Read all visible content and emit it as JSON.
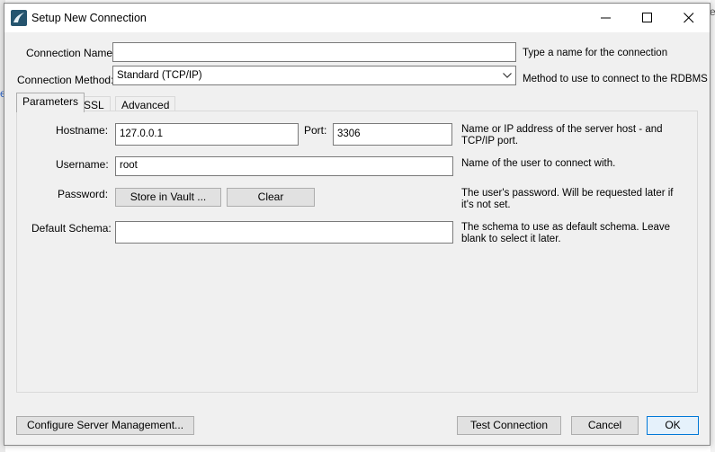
{
  "window": {
    "title": "Setup New Connection"
  },
  "form": {
    "connection_name_label": "Connection Name:",
    "connection_name_value": "",
    "connection_name_help": "Type a name for the connection",
    "connection_method_label": "Connection Method:",
    "connection_method_value": "Standard (TCP/IP)",
    "connection_method_help": "Method to use to connect to the RDBMS"
  },
  "tabs": [
    {
      "label": "Parameters",
      "active": true
    },
    {
      "label": "SSL",
      "active": false
    },
    {
      "label": "Advanced",
      "active": false
    }
  ],
  "parameters": {
    "hostname_label": "Hostname:",
    "hostname_value": "127.0.0.1",
    "port_label": "Port:",
    "port_value": "3306",
    "hostname_help": "Name or IP address of the server host - and TCP/IP port.",
    "username_label": "Username:",
    "username_value": "root",
    "username_help": "Name of the user to connect with.",
    "password_label": "Password:",
    "store_in_vault": "Store in Vault ...",
    "clear": "Clear",
    "password_help": "The user's password. Will be requested later if it's not set.",
    "schema_label": "Default Schema:",
    "schema_value": "",
    "schema_help": "The schema to use as default schema. Leave blank to select it later."
  },
  "footer": {
    "configure": "Configure Server Management...",
    "test": "Test Connection",
    "cancel": "Cancel",
    "ok": "OK"
  },
  "background": {
    "left_glyph": "e",
    "right_glyph": "e"
  },
  "colors": {
    "ok_border": "#0078d7",
    "app_icon": "#25546e"
  }
}
